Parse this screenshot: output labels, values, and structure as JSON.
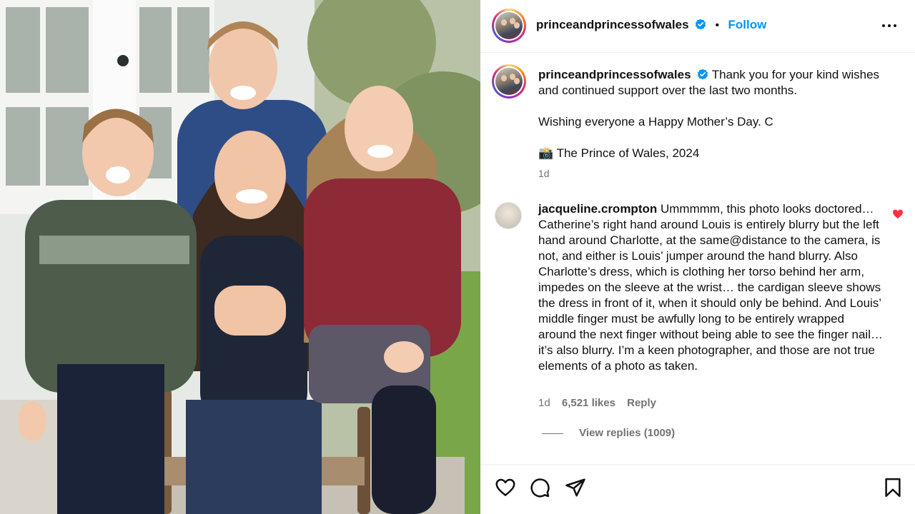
{
  "post": {
    "username": "princeandprincessofwales",
    "separator": "•",
    "follow_label": "Follow",
    "verified_icon": "verified-badge-icon",
    "accent_color": "#0095f6"
  },
  "caption": {
    "username": "princeandprincessofwales",
    "line1": "Thank you for your kind wishes and continued support over the last two months.",
    "line2": "Wishing everyone a Happy Mother’s Day. C",
    "line3_icon": "📸",
    "line3": "The Prince of Wales, 2024",
    "time": "1d"
  },
  "comment": {
    "username": "jacqueline.crompton",
    "text": "Ummmmm, this photo looks doctored… Catherine’s right hand around Louis is entirely blurry but the left hand around Charlotte, at the same@distance to the camera, is not, and either is Louis’ jumper around the hand blurry. Also Charlotte’s dress, which is clothing her torso behind her arm, impedes on the sleeve at the wrist… the cardigan sleeve shows the dress in front of it, when it should only be behind. And Louis’ middle finger must be awfully long to be entirely wrapped around the next finger without being able to see the finger nail… it’s also blurry. I’m a keen photographer, and those are not true elements of a photo as taken.",
    "time": "1d",
    "likes": "6,521 likes",
    "reply_label": "Reply",
    "view_replies": "View replies (1009)",
    "liked_color": "#ff3040"
  },
  "actions": {
    "icons": [
      "heart-icon",
      "comment-icon",
      "share-icon",
      "bookmark-icon"
    ]
  }
}
